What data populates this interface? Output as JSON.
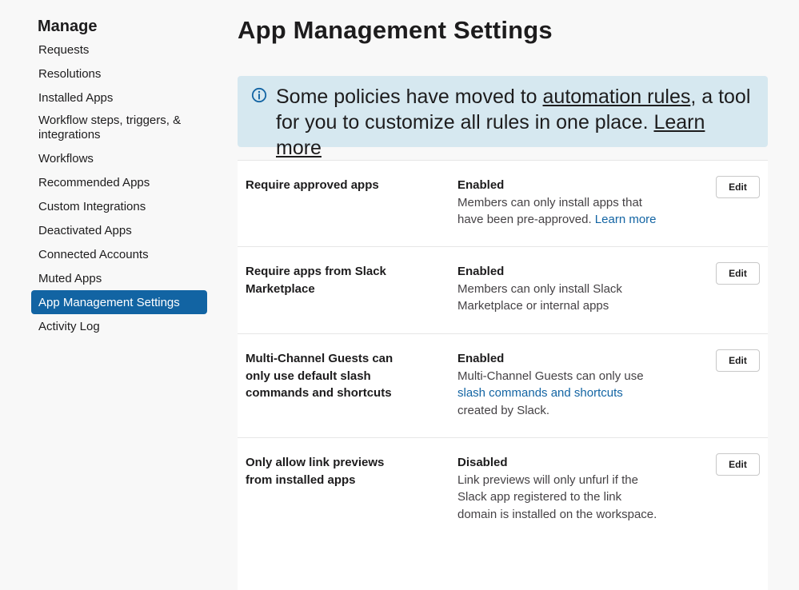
{
  "sidebar": {
    "title": "Manage",
    "items": [
      {
        "label": "Requests"
      },
      {
        "label": "Resolutions"
      },
      {
        "label": "Installed Apps"
      },
      {
        "label": "Workflow steps, triggers, & integrations"
      },
      {
        "label": "Workflows"
      },
      {
        "label": "Recommended Apps"
      },
      {
        "label": "Custom Integrations"
      },
      {
        "label": "Deactivated Apps"
      },
      {
        "label": "Connected Accounts"
      },
      {
        "label": "Muted Apps"
      },
      {
        "label": "App Management Settings",
        "active": true
      },
      {
        "label": "Activity Log"
      }
    ]
  },
  "main": {
    "title": "App Management Settings",
    "banner": {
      "icon": "info-icon",
      "text_before": "Some policies have moved to ",
      "link_text": "automation rules",
      "text_after": ", a tool for you to customize all rules in one place. ",
      "learn_more": "Learn more"
    },
    "settings": [
      {
        "name": "Require approved apps",
        "status": "Enabled",
        "desc_before": "Members can only install apps that have been pre-approved. ",
        "link": "Learn more",
        "desc_after": "",
        "edit": "Edit"
      },
      {
        "name": "Require apps from Slack Marketplace",
        "status": "Enabled",
        "desc_before": "Members can only install Slack Marketplace or internal apps",
        "link": "",
        "desc_after": "",
        "edit": "Edit"
      },
      {
        "name": "Multi-Channel Guests can only use default slash commands and shortcuts",
        "status": "Enabled",
        "desc_before": "Multi-Channel Guests can only use ",
        "link": "slash commands and shortcuts",
        "desc_after": " created by Slack.",
        "edit": "Edit"
      },
      {
        "name": "Only allow link previews from installed apps",
        "status": "Disabled",
        "desc_before": "Link previews will only unfurl if the Slack app registered to the link domain is installed on the workspace.",
        "link": "",
        "desc_after": "",
        "edit": "Edit"
      }
    ]
  },
  "colors": {
    "accent": "#1264a3",
    "banner_bg": "#d6e8f0",
    "text": "#1d1c1d"
  }
}
